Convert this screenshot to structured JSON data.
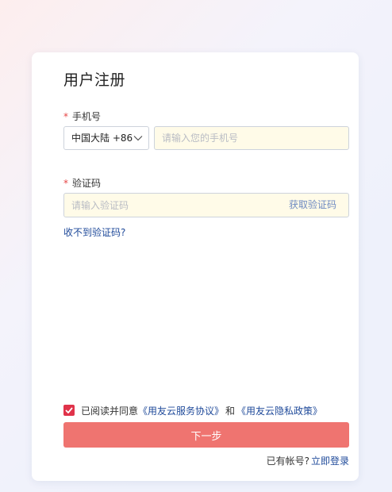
{
  "form": {
    "title": "用户注册",
    "required_mark": "*",
    "phone": {
      "label": "手机号",
      "country_value": "中国大陆 +86",
      "placeholder": "请输入您的手机号",
      "value": ""
    },
    "code": {
      "label": "验证码",
      "placeholder": "请输入验证码",
      "value": "",
      "get_code_label": "获取验证码"
    },
    "no_code_link": "收不到验证码?",
    "agreement": {
      "checked": true,
      "prefix": "已阅读并同意",
      "service_link": "《用友云服务协议》",
      "and": "和",
      "privacy_link": "《用友云隐私政策》"
    },
    "next_button": "下一步",
    "login": {
      "prefix": "已有帐号?",
      "link": "立即登录"
    }
  },
  "colors": {
    "accent": "#e0334a",
    "button": "#ef7470",
    "link": "#1f4a9a",
    "input_bg": "#fffbe8"
  }
}
